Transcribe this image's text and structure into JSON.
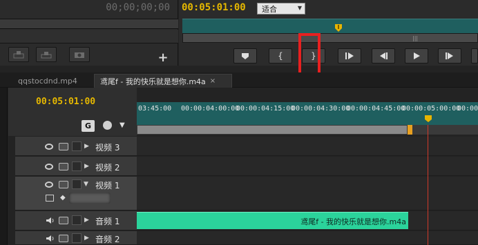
{
  "source_monitor": {
    "timecode": "00;00;00;00",
    "add_label": "+"
  },
  "program_monitor": {
    "timecode": "00:05:01:00",
    "fit_select": "适合",
    "controls": [
      "mark-in-marker",
      "mark-in",
      "mark-out",
      "go-to-in",
      "step-back",
      "play",
      "step-forward"
    ]
  },
  "tabs": [
    {
      "label": "qqstocdnd.mp4",
      "active": false
    },
    {
      "label": "鸢尾f - 我的快乐就是想你.m4a",
      "active": true,
      "close": "×"
    }
  ],
  "timeline": {
    "timecode": "00:05:01:00",
    "snap_label": "G",
    "ruler_ticks": [
      "03:45:00",
      "00:00:04:00:00",
      "00:00:04:15:00",
      "00:00:04:30:00",
      "00:00:04:45:00",
      "00:00:05:00:00",
      "00:00:"
    ],
    "tracks": {
      "video3": "视频 3",
      "video2": "视频 2",
      "video1": "视频 1",
      "audio1": "音频 1",
      "audio2": "音频 2"
    },
    "audio_clip_label": "鸢尾f - 我的快乐就是想你.m4a"
  },
  "colors": {
    "timecode_accent": "#e6b800",
    "ruler_teal": "#1f5f5f",
    "audio_clip": "#2bd39b",
    "highlight": "#e82020",
    "playhead": "#d23a2a"
  }
}
